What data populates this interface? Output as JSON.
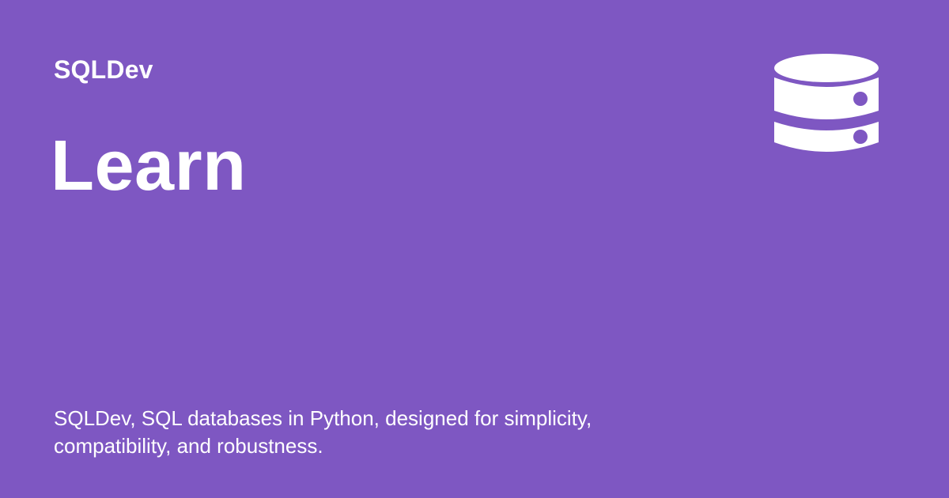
{
  "header": {
    "brand": "SQLDev",
    "logo_icon": "database-icon"
  },
  "main": {
    "title": "Learn",
    "description": "SQLDev, SQL databases in Python, designed for simplicity, compatibility, and robustness."
  },
  "colors": {
    "background": "#7e57c2",
    "text": "#ffffff"
  }
}
